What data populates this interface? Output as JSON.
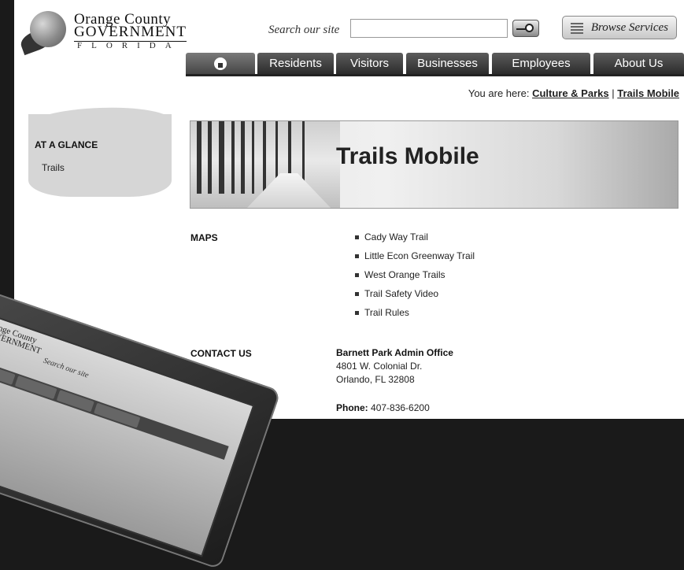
{
  "logo": {
    "line1": "Orange County",
    "line2": "GOVERNMENT",
    "line3": "FLORIDA"
  },
  "search": {
    "label": "Search our site",
    "placeholder": ""
  },
  "browse": {
    "label": "Browse Services"
  },
  "nav": {
    "tabs": [
      "Residents",
      "Visitors",
      "Businesses",
      "Employees",
      "About Us"
    ]
  },
  "breadcrumb": {
    "prefix": "You are here:",
    "items": [
      "Culture & Parks",
      "Trails Mobile"
    ],
    "separator": "|"
  },
  "sidebar": {
    "title": "AT A GLANCE",
    "items": [
      "Trails"
    ]
  },
  "banner": {
    "title": "Trails Mobile"
  },
  "maps": {
    "label": "MAPS",
    "items": [
      "Cady Way Trail",
      "Little Econ Greenway Trail",
      "West Orange Trails",
      "Trail Safety Video",
      "Trail Rules"
    ]
  },
  "contact": {
    "label": "CONTACT US",
    "name": "Barnett Park Admin Office",
    "address1": "4801 W. Colonial Dr.",
    "address2": "Orlando, FL 32808",
    "phone_label": "Phone:",
    "phone": "407-836-6200"
  },
  "device": {
    "logo1": "Orange County",
    "logo2": "GOVERNMENT",
    "search": "Search our site"
  }
}
